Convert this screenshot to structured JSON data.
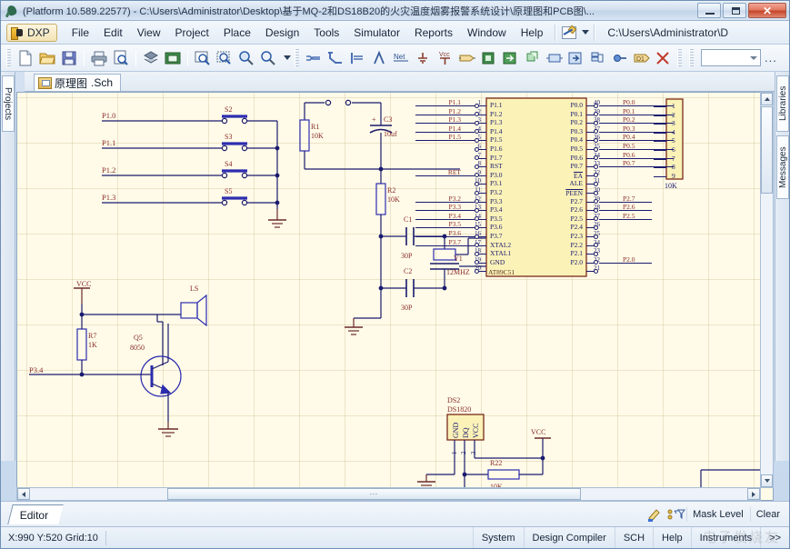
{
  "window": {
    "title": "(Platform 10.589.22577) - C:\\Users\\Administrator\\Desktop\\基于MQ-2和DS18B20的火灾温度烟雾报警系统设计\\原理图和PCB图\\...",
    "app_icon": "altium-icon",
    "minimize_label": "Minimize",
    "maximize_label": "Maximize",
    "close_label": "Close"
  },
  "menubar": {
    "dxp_label": "DXP",
    "items": [
      {
        "label": "File"
      },
      {
        "label": "Edit"
      },
      {
        "label": "View"
      },
      {
        "label": "Project"
      },
      {
        "label": "Place"
      },
      {
        "label": "Design"
      },
      {
        "label": "Tools"
      },
      {
        "label": "Simulator"
      },
      {
        "label": "Reports"
      },
      {
        "label": "Window"
      },
      {
        "label": "Help"
      }
    ],
    "path_text": "C:\\Users\\Administrator\\D"
  },
  "toolbar": {
    "icons": [
      "new-document-icon",
      "open-folder-icon",
      "save-icon",
      "print-icon",
      "print-preview-icon",
      "open-project-icon",
      "component-library-icon",
      "zoom-area-icon",
      "zoom-selection-icon",
      "zoom-in-icon",
      "zoom-out-icon",
      "wire-icon",
      "bus-icon",
      "bus-entry-icon",
      "line-icon",
      "net-label-icon",
      "gnd-power-port-icon",
      "vcc-power-port-icon",
      "port-icon",
      "sheet-symbol-icon",
      "sheet-entry-icon",
      "device-sheet-icon",
      "part-icon",
      "place-part-icon",
      "hierarchy-icon",
      "no-erc-icon",
      "annotate-icon",
      "cross-probe-icon"
    ],
    "combo_value": "",
    "overflow_label": "..."
  },
  "document_tab": {
    "label": "原理图",
    "extension": ".Sch",
    "icon": "schematic-document-icon"
  },
  "docks": {
    "left": [
      {
        "label": "Projects"
      }
    ],
    "right": [
      {
        "label": "Libraries"
      },
      {
        "label": "Messages"
      }
    ]
  },
  "panel_strip": {
    "editor_tab": "Editor",
    "icons": [
      "highlight-pen-icon",
      "mask-filter-icon"
    ],
    "buttons": [
      {
        "label": "Mask Level"
      },
      {
        "label": "Clear"
      }
    ]
  },
  "statusbar": {
    "coords": "X:990 Y:520   Grid:10",
    "items": [
      {
        "label": "System"
      },
      {
        "label": "Design Compiler"
      },
      {
        "label": "SCH"
      },
      {
        "label": "Help"
      },
      {
        "label": "Instruments"
      },
      {
        "label": ">>"
      }
    ],
    "watermark": "电子发烧友"
  },
  "schematic": {
    "ic": {
      "designator": "AT89C51",
      "left_pins": [
        {
          "num": "1",
          "name": "P1.1",
          "net": "P1.1"
        },
        {
          "num": "2",
          "name": "P1.2",
          "net": "P1.2"
        },
        {
          "num": "3",
          "name": "P1.3",
          "net": "P1.3"
        },
        {
          "num": "4",
          "name": "P1.4",
          "net": "P1.4"
        },
        {
          "num": "5",
          "name": "P1.5",
          "net": "P1.5"
        },
        {
          "num": "6",
          "name": "P1.6",
          "net": ""
        },
        {
          "num": "7",
          "name": "P1.7",
          "net": ""
        },
        {
          "num": "8",
          "name": "RST",
          "net": ""
        },
        {
          "num": "9",
          "name": "P3.0",
          "net": "RET"
        },
        {
          "num": "10",
          "name": "P3.1",
          "net": ""
        },
        {
          "num": "11",
          "name": "P3.2",
          "net": ""
        },
        {
          "num": "12",
          "name": "P3.3",
          "net": "P3.2"
        },
        {
          "num": "13",
          "name": "P3.4",
          "net": "P3.3"
        },
        {
          "num": "14",
          "name": "P3.5",
          "net": "P3.4"
        },
        {
          "num": "15",
          "name": "P3.6",
          "net": "P3.5"
        },
        {
          "num": "16",
          "name": "P3.7",
          "net": "P3.6"
        },
        {
          "num": "17",
          "name": "XTAL2",
          "net": "P3.7"
        },
        {
          "num": "18",
          "name": "XTAL1",
          "net": ""
        },
        {
          "num": "19",
          "name": "GND",
          "net": ""
        },
        {
          "num": "20",
          "name": "",
          "net": ""
        }
      ],
      "right_pins": [
        {
          "num": "40",
          "name": "P0.0",
          "net": "P0.0"
        },
        {
          "num": "39",
          "name": "P0.1",
          "net": "P0.1"
        },
        {
          "num": "38",
          "name": "P0.2",
          "net": "P0.2"
        },
        {
          "num": "37",
          "name": "P0.3",
          "net": "P0.3"
        },
        {
          "num": "36",
          "name": "P0.4",
          "net": "P0.4"
        },
        {
          "num": "35",
          "name": "P0.5",
          "net": "P0.5"
        },
        {
          "num": "34",
          "name": "P0.6",
          "net": "P0.6"
        },
        {
          "num": "33",
          "name": "P0.7",
          "net": "P0.7"
        },
        {
          "num": "32",
          "name": "EA",
          "net": ""
        },
        {
          "num": "31",
          "name": "ALE",
          "net": ""
        },
        {
          "num": "30",
          "name": "PEEN",
          "net": ""
        },
        {
          "num": "29",
          "name": "P2.7",
          "net": "P2.7"
        },
        {
          "num": "28",
          "name": "P2.6",
          "net": "P2.6"
        },
        {
          "num": "27",
          "name": "P2.5",
          "net": "P2.5"
        },
        {
          "num": "26",
          "name": "P2.4",
          "net": ""
        },
        {
          "num": "25",
          "name": "P2.3",
          "net": ""
        },
        {
          "num": "24",
          "name": "P2.2",
          "net": ""
        },
        {
          "num": "23",
          "name": "P2.1",
          "net": ""
        },
        {
          "num": "22",
          "name": "P2.0",
          "net": "P2.0"
        },
        {
          "num": "21",
          "name": "",
          "net": ""
        }
      ]
    },
    "switches": [
      {
        "designator": "S2",
        "net": "P1.0"
      },
      {
        "designator": "S3",
        "net": "P1.1"
      },
      {
        "designator": "S4",
        "net": "P1.2"
      },
      {
        "designator": "S5",
        "net": "P1.3"
      }
    ],
    "components": [
      {
        "designator": "R1",
        "value": "10K"
      },
      {
        "designator": "C3",
        "value": "10uf",
        "polarity": "+"
      },
      {
        "designator": "R2",
        "value": "10K"
      },
      {
        "designator": "C1",
        "value": "30P"
      },
      {
        "designator": "C2",
        "value": "30P"
      },
      {
        "designator": "Y1",
        "value": "12MHZ"
      },
      {
        "designator": "R7",
        "value": "1K"
      },
      {
        "designator": "Q5",
        "value": "8050"
      },
      {
        "designator": "LS",
        "value": ""
      },
      {
        "designator": "R22",
        "value": "10K"
      },
      {
        "designator": "DS2",
        "value": "DS1820"
      }
    ],
    "resistor_network": {
      "value": "10K",
      "pins": [
        "1",
        "2",
        "3",
        "4",
        "5",
        "6",
        "7",
        "8",
        "9"
      ]
    },
    "ds1820": {
      "designator": "DS2",
      "part": "DS1820",
      "pins": [
        {
          "num": "1",
          "name": "GND"
        },
        {
          "num": "2",
          "name": "DQ"
        },
        {
          "num": "3",
          "name": "VCC"
        }
      ]
    },
    "power_labels": [
      "VCC",
      "VCC",
      "VCC"
    ],
    "net_labels": [
      "P3.4",
      "P2.0",
      "RET"
    ],
    "partial_label": "R"
  }
}
